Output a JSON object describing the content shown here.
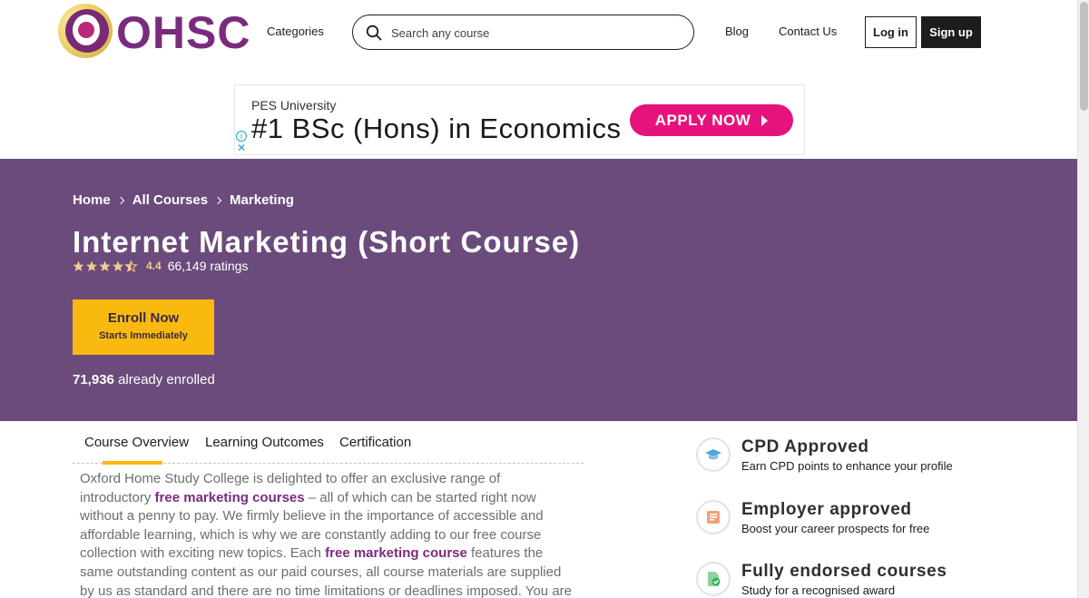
{
  "header": {
    "logo_text": "OHSC",
    "categories": "Categories",
    "search_placeholder": "Search any course",
    "blog": "Blog",
    "contact": "Contact Us",
    "login": "Log in",
    "signup": "Sign up"
  },
  "ad": {
    "university": "PES University",
    "headline": "#1 BSc (Hons) in Economics",
    "cta": "APPLY NOW",
    "info_glyph": "i",
    "close_glyph": "✕",
    "cta_color": "#e6137d"
  },
  "hero": {
    "breadcrumb": [
      "Home",
      "All Courses",
      "Marketing"
    ],
    "title": "Internet Marketing (Short Course)",
    "rating": "4.4",
    "ratings_count": "66,149 ratings",
    "enroll_label": "Enroll Now",
    "enroll_sub": "Starts Immediately",
    "enrolled_count": "71,936",
    "enrolled_text": "already enrolled",
    "bg_color": "#6b4b7b",
    "accent_color": "#f9b90f"
  },
  "tabs": [
    "Course Overview",
    "Learning Outcomes",
    "Certification"
  ],
  "overview": {
    "p1": "Oxford Home Study College is delighted to offer an exclusive range of introductory ",
    "b1": "free marketing courses",
    "p2": " – all of which can be started right now without a penny to pay.  We firmly believe in the importance of accessible and affordable learning, which is why we are constantly adding to our free course collection with exciting new topics.  Each ",
    "b2": "free marketing course",
    "p3": " features the same outstanding content as our paid courses, all course materials are supplied by us as standard and there are no time limitations or deadlines imposed.  You are therefore free to study from anywhere in the world, at a"
  },
  "features": [
    {
      "title": "CPD Approved",
      "subtitle": "Earn CPD points to enhance your profile",
      "icon": "graduation-cap-icon"
    },
    {
      "title": "Employer approved",
      "subtitle": "Boost your career prospects for free",
      "icon": "certificate-icon"
    },
    {
      "title": "Fully endorsed courses",
      "subtitle": "Study for a recognised award",
      "icon": "document-check-icon"
    }
  ]
}
